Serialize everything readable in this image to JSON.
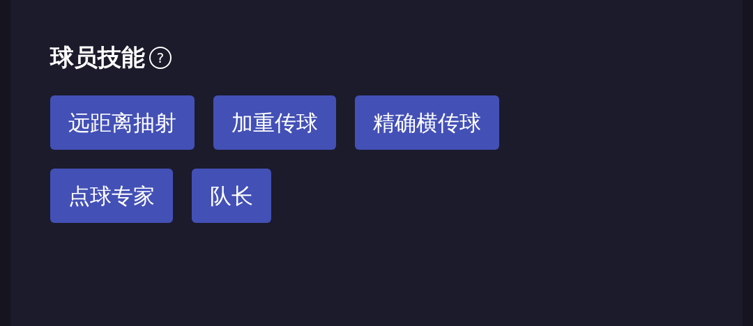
{
  "section": {
    "title": "球员技能",
    "help_icon": "?"
  },
  "skills": [
    {
      "label": "远距离抽射"
    },
    {
      "label": "加重传球"
    },
    {
      "label": "精确横传球"
    },
    {
      "label": "点球专家"
    },
    {
      "label": "队长"
    }
  ]
}
